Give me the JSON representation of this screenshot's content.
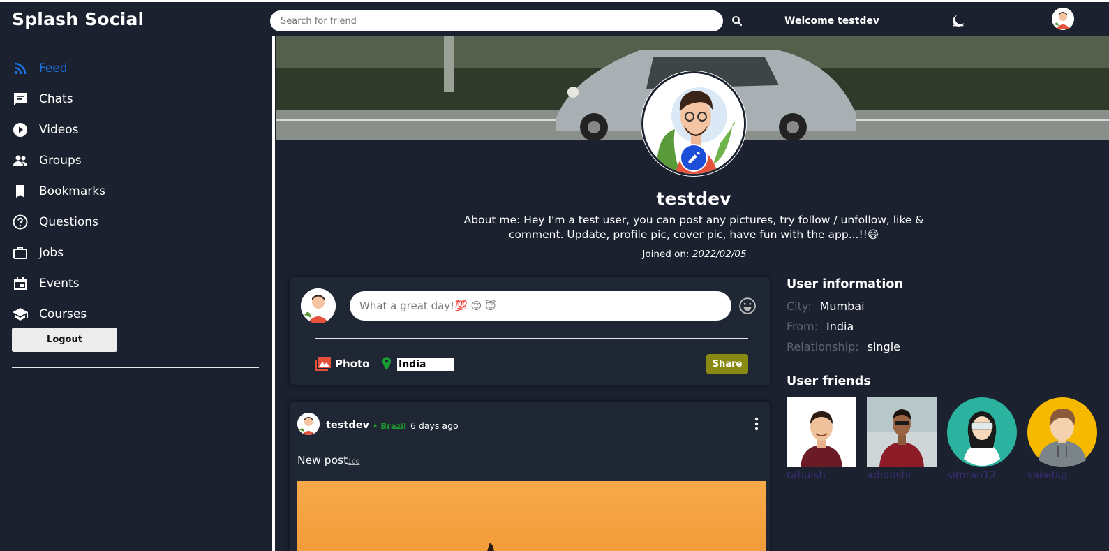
{
  "header": {
    "app_title": "Splash Social",
    "search_placeholder": "Search for friend",
    "welcome_text": "Welcome testdev"
  },
  "sidebar": {
    "items": [
      {
        "label": "Feed",
        "icon": "rss-icon"
      },
      {
        "label": "Chats",
        "icon": "chat-icon"
      },
      {
        "label": "Videos",
        "icon": "play-circle-icon"
      },
      {
        "label": "Groups",
        "icon": "group-icon"
      },
      {
        "label": "Bookmarks",
        "icon": "bookmark-icon"
      },
      {
        "label": "Questions",
        "icon": "help-circle-icon"
      },
      {
        "label": "Jobs",
        "icon": "briefcase-icon"
      },
      {
        "label": "Events",
        "icon": "calendar-icon"
      },
      {
        "label": "Courses",
        "icon": "school-icon"
      }
    ],
    "logout_label": "Logout"
  },
  "profile": {
    "username": "testdev",
    "about": "About me: Hey I'm a test user, you can post any pictures, try follow / unfollow, like & comment. Update, profile pic, cover pic, have fun with the app...!!😄",
    "joined_label": "Joined on: ",
    "joined_date": "2022/02/05"
  },
  "share": {
    "placeholder": "What a great day!💯 😍 😇",
    "photo_label": "Photo",
    "location_value": "India",
    "share_label": "Share"
  },
  "post": {
    "user": "testdev",
    "location": "• Brazil",
    "time": "6 days ago",
    "text": "New post",
    "text_emoji": "100"
  },
  "user_info": {
    "title": "User information",
    "city_label": "City:",
    "city": "Mumbai",
    "from_label": "From:",
    "from": "India",
    "relationship_label": "Relationship:",
    "relationship": "single"
  },
  "friends": {
    "title": "User friends",
    "list": [
      {
        "name": "rahulsh"
      },
      {
        "name": "adidoshi"
      },
      {
        "name": "simran12"
      },
      {
        "name": "saketsg"
      }
    ]
  },
  "colors": {
    "background": "#1b212e",
    "accent_blue": "#1a73e8",
    "share_button": "#8a8a12",
    "friend_name": "#3b2d7a",
    "location_green": "#1f9d2d"
  }
}
